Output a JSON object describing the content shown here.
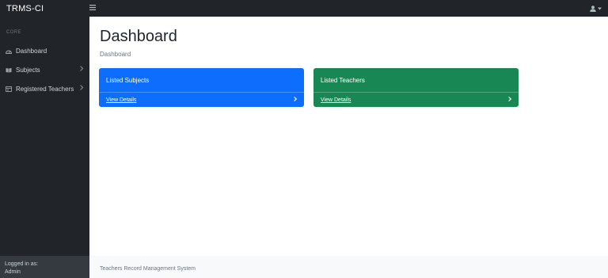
{
  "topnav": {
    "brand": "TRMS-CI",
    "toggle_icon": "bars-icon",
    "user_icon": "user-icon"
  },
  "sidebar": {
    "heading": "CORE",
    "items": [
      {
        "label": "Dashboard",
        "icon": "tachometer-icon",
        "has_submenu": false
      },
      {
        "label": "Subjects",
        "icon": "book-icon",
        "has_submenu": true
      },
      {
        "label": "Registered Teachers",
        "icon": "table-icon",
        "has_submenu": true
      }
    ],
    "footer": {
      "logged_in_label": "Logged in as:",
      "user": "Admin"
    }
  },
  "main": {
    "title": "Dashboard",
    "breadcrumb": "Dashboard",
    "cards": [
      {
        "title": "Listed Subjects",
        "link": "View Details",
        "color": "#0d6efd"
      },
      {
        "title": "Listed Teachers",
        "link": "View Details",
        "color": "#198754"
      }
    ]
  },
  "footer": {
    "text": "Teachers Record Management System"
  },
  "colors": {
    "nav_bg": "#212529",
    "primary": "#0d6efd",
    "success": "#198754",
    "footer_bg": "#f8f9fa"
  }
}
